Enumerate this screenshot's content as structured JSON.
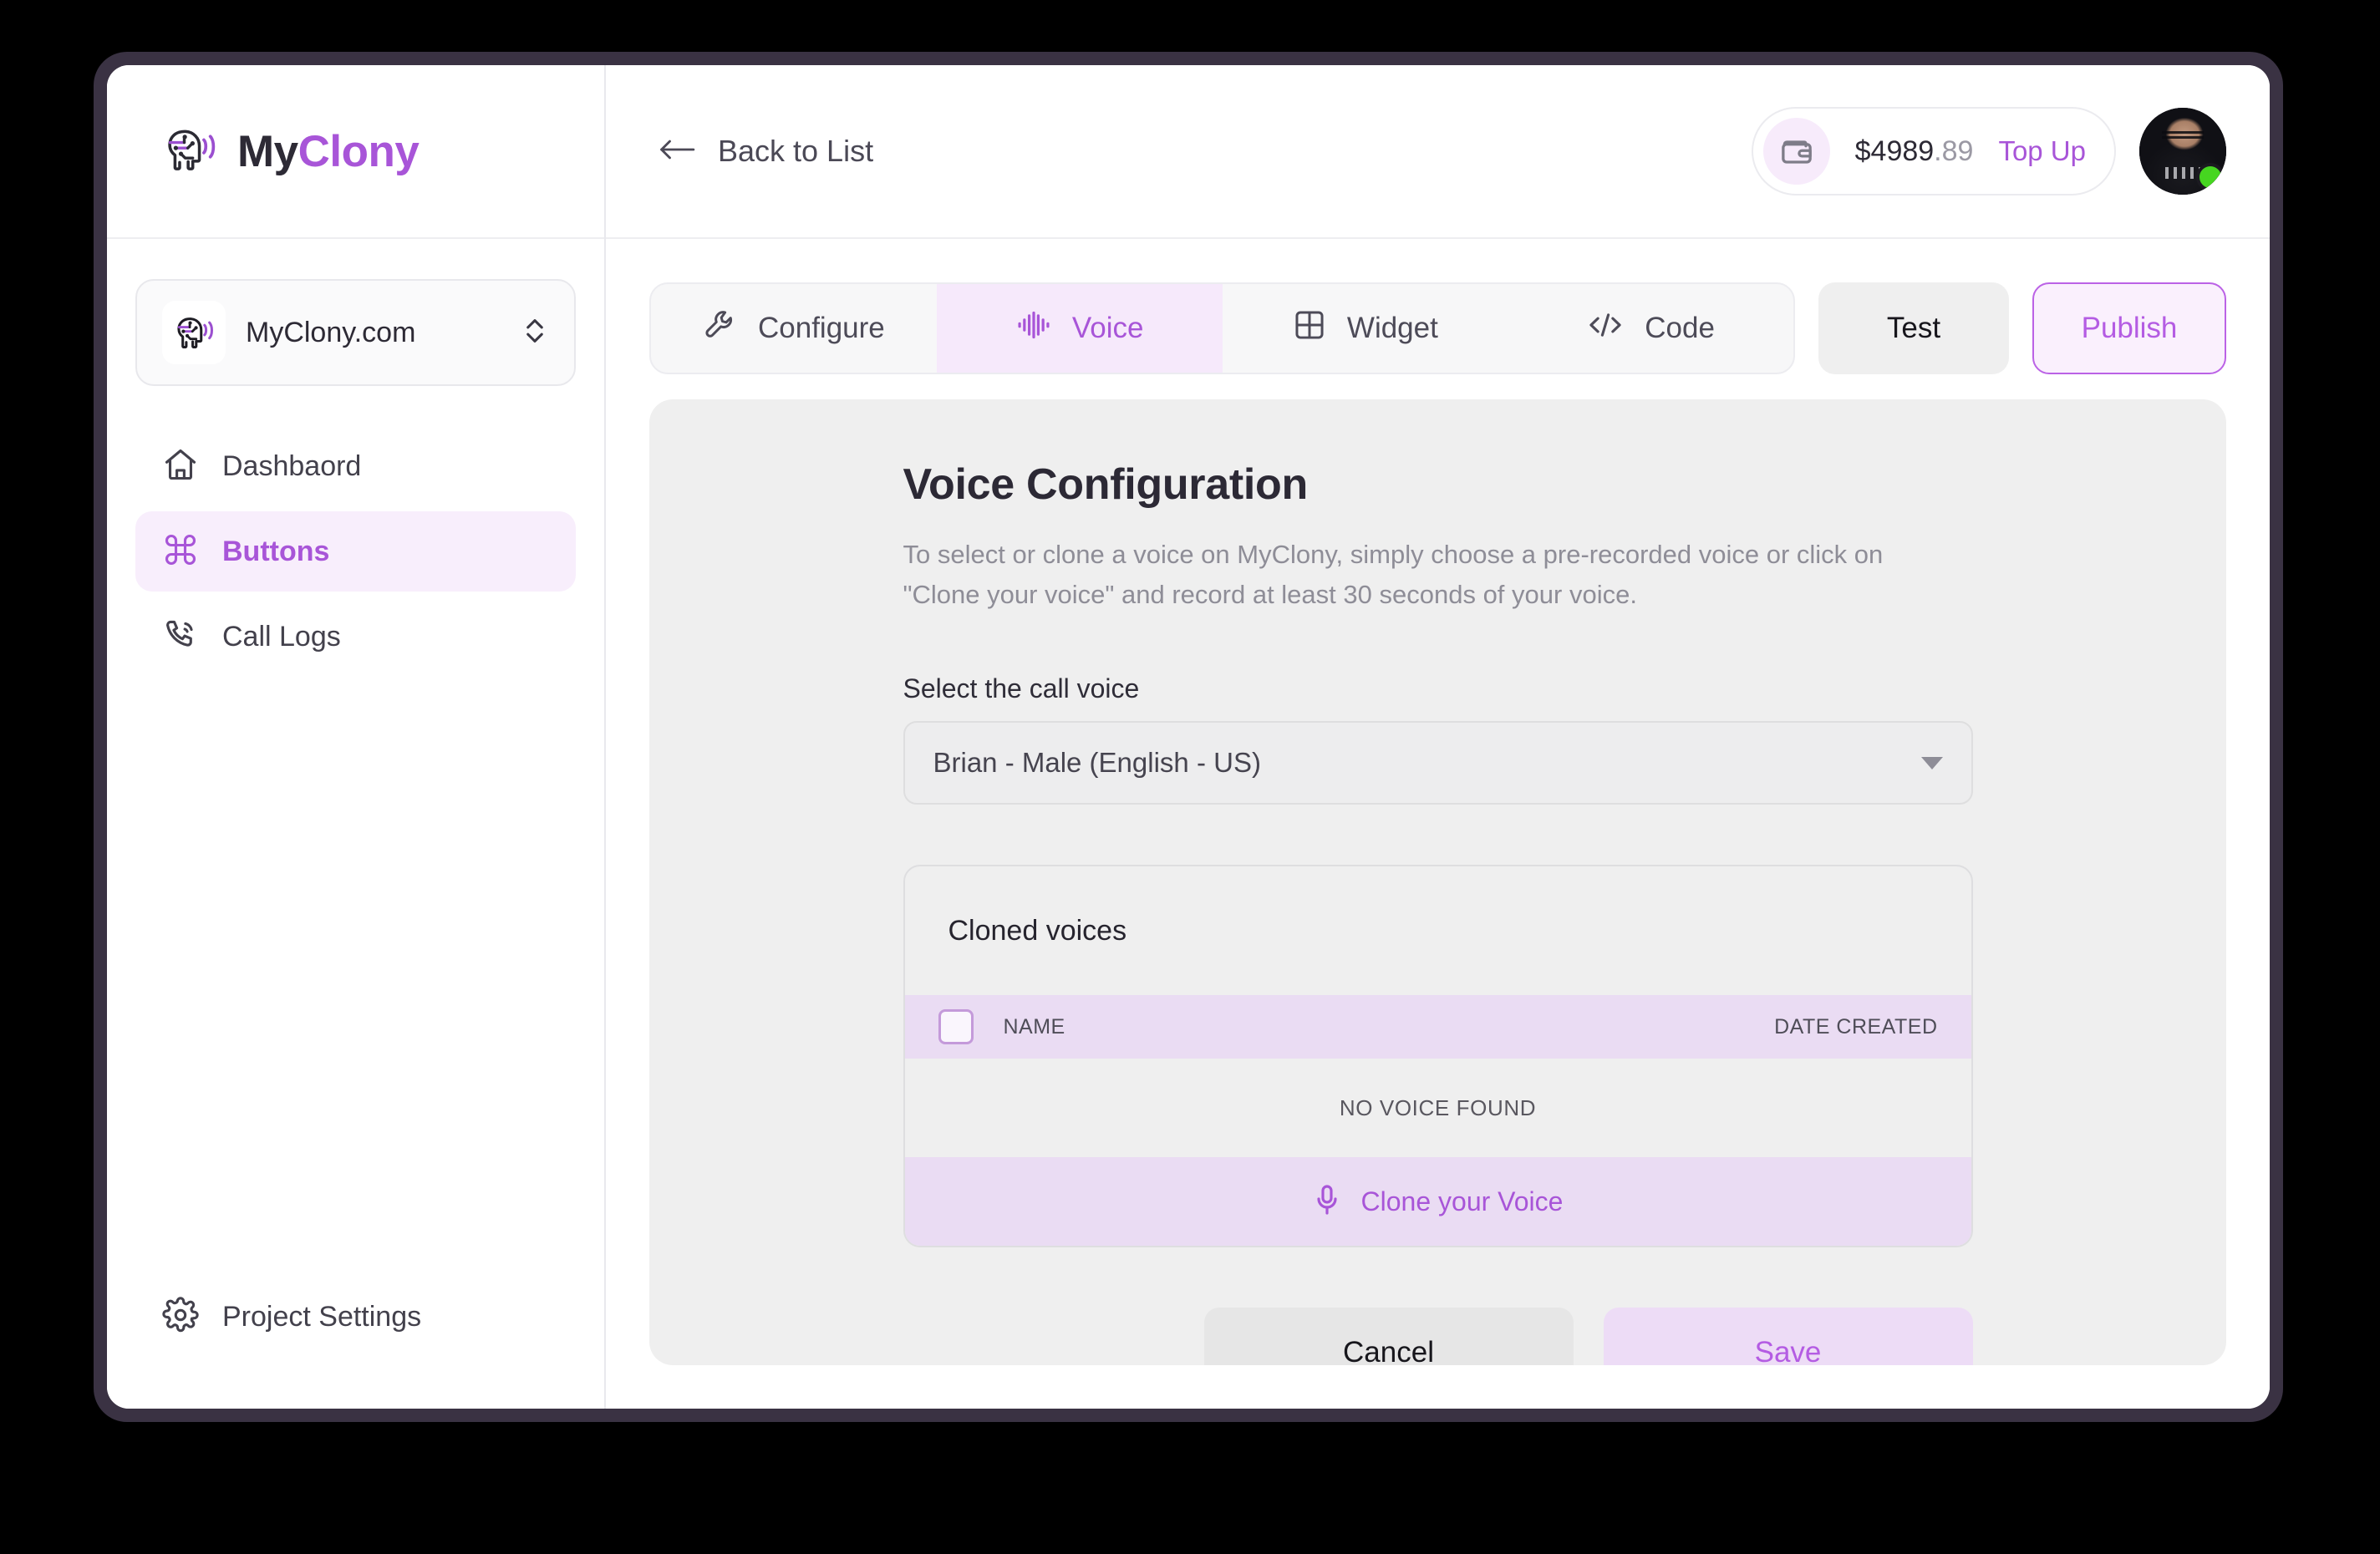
{
  "brand": {
    "name_prefix": "My",
    "name_suffix": "Clony",
    "logo_icon": "clony-head-waves-icon"
  },
  "sidebar": {
    "project_switcher": {
      "label": "MyClony.com",
      "logo_icon": "clony-head-waves-icon",
      "chevron_icon": "chevron-up-down-icon"
    },
    "items": [
      {
        "label": "Dashbaord",
        "icon": "home-icon",
        "active": false
      },
      {
        "label": "Buttons",
        "icon": "command-icon",
        "active": true
      },
      {
        "label": "Call Logs",
        "icon": "phone-call-icon",
        "active": false
      }
    ],
    "bottom_item": {
      "label": "Project Settings",
      "icon": "gear-icon"
    }
  },
  "topbar": {
    "back_label": "Back to List",
    "back_icon": "arrow-left-icon",
    "wallet_icon": "wallet-icon",
    "balance_main": "$4989",
    "balance_cents": ".89",
    "topup_label": "Top Up",
    "avatar_icon": "user-avatar",
    "status": "online"
  },
  "tabs": [
    {
      "label": "Configure",
      "icon": "wrench-icon",
      "active": false
    },
    {
      "label": "Voice",
      "icon": "audio-waveform-icon",
      "active": true
    },
    {
      "label": "Widget",
      "icon": "grid-icon",
      "active": false
    },
    {
      "label": "Code",
      "icon": "code-brackets-icon",
      "active": false
    }
  ],
  "toolbar": {
    "test_label": "Test",
    "publish_label": "Publish"
  },
  "main": {
    "title": "Voice Configuration",
    "description": "To select or clone a voice on MyClony, simply choose a pre-recorded voice or click on \"Clone your voice\" and record at least 30 seconds of your voice.",
    "select_label": "Select the call voice",
    "select_value": "Brian - Male (English - US)",
    "select_caret_icon": "caret-down-icon"
  },
  "voices_card": {
    "heading": "Cloned voices",
    "select_all_checkbox": "select-all-checkbox",
    "columns": [
      "NAME",
      "DATE CREATED"
    ],
    "rows": [],
    "empty_text": "NO VOICE FOUND",
    "clone_label": "Clone your Voice",
    "clone_icon": "microphone-icon"
  },
  "actions": {
    "cancel_label": "Cancel",
    "save_label": "Save"
  },
  "colors": {
    "accent": "#a855d8",
    "accent_soft": "#f8eefc",
    "table_header": "#eadcf3",
    "panel_bg": "#efefef",
    "bezel": "#3a3243",
    "online": "#46d620"
  }
}
